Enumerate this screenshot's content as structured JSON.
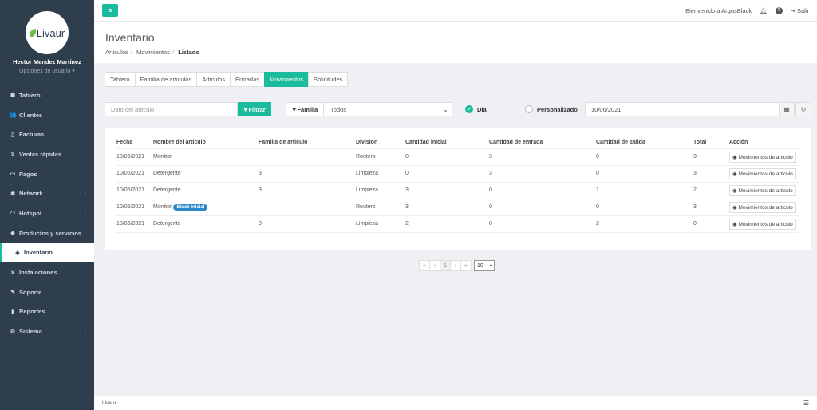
{
  "sidebar": {
    "logo_text": "Livaur",
    "user_name": "Hector Mendez Martínez",
    "user_options": "Opciones de usuario ▾",
    "items": [
      {
        "label": "Tablero"
      },
      {
        "label": "Clientes"
      },
      {
        "label": "Facturas"
      },
      {
        "label": "Ventas rápidas"
      },
      {
        "label": "Pagos"
      },
      {
        "label": "Network"
      },
      {
        "label": "Hotspot"
      },
      {
        "label": "Productos y servicios"
      },
      {
        "label": "Inventario"
      },
      {
        "label": "Instalaciones"
      },
      {
        "label": "Soporte"
      },
      {
        "label": "Reportes"
      },
      {
        "label": "Sistema"
      }
    ]
  },
  "topbar": {
    "welcome": "Bienvenido a ArgusBlack",
    "logout": "Salir"
  },
  "header": {
    "title": "Inventario",
    "breadcrumb": [
      "Articulos",
      "Movimientos",
      "Listado"
    ]
  },
  "tabs": [
    "Tablero",
    "Familia de articulos",
    "Articulos",
    "Entradas",
    "Movimientos",
    "Solicitudes"
  ],
  "filters": {
    "search_placeholder": "Dato del articulo",
    "filter_button": "Filtrar",
    "family_label": "Familia",
    "family_value": "Todos",
    "radio_day": "Dia",
    "radio_custom": "Personalizado",
    "date_value": "10/06/2021"
  },
  "table": {
    "headers": [
      "Fecha",
      "Nombre del articulo",
      "Familia de articulo",
      "División",
      "Cantidad inicial",
      "Cantidad de entrada",
      "Cantidad de salida",
      "Total",
      "Acción"
    ],
    "action_label": "Movimientos de articulo",
    "rows": [
      {
        "fecha": "10/06/2021",
        "nombre": "Monitor",
        "badge": "",
        "familia": "",
        "division": "Routers",
        "inicial": "0",
        "entrada": "3",
        "salida": "0",
        "total": "3"
      },
      {
        "fecha": "10/06/2021",
        "nombre": "Detergente",
        "badge": "",
        "familia": "3",
        "division": "Limpieza",
        "inicial": "0",
        "entrada": "3",
        "salida": "0",
        "total": "3"
      },
      {
        "fecha": "10/06/2021",
        "nombre": "Detergente",
        "badge": "",
        "familia": "3",
        "division": "Limpieza",
        "inicial": "3",
        "entrada": "0",
        "salida": "1",
        "total": "2"
      },
      {
        "fecha": "10/06/2021",
        "nombre": "Monitor",
        "badge": "Stock inicial",
        "familia": "",
        "division": "Routers",
        "inicial": "3",
        "entrada": "0",
        "salida": "0",
        "total": "3"
      },
      {
        "fecha": "10/06/2021",
        "nombre": "Detergente",
        "badge": "",
        "familia": "3",
        "division": "Limpieza",
        "inicial": "2",
        "entrada": "0",
        "salida": "2",
        "total": "0"
      }
    ]
  },
  "pagination": {
    "first": "«",
    "prev": "‹",
    "current": "1",
    "next": "›",
    "last": "»",
    "page_size": "10"
  },
  "footer": {
    "text": "Livaur"
  },
  "colors": {
    "accent": "#1abc9c",
    "sidebar": "#2f3e4c",
    "badge": "#2a87c8"
  }
}
